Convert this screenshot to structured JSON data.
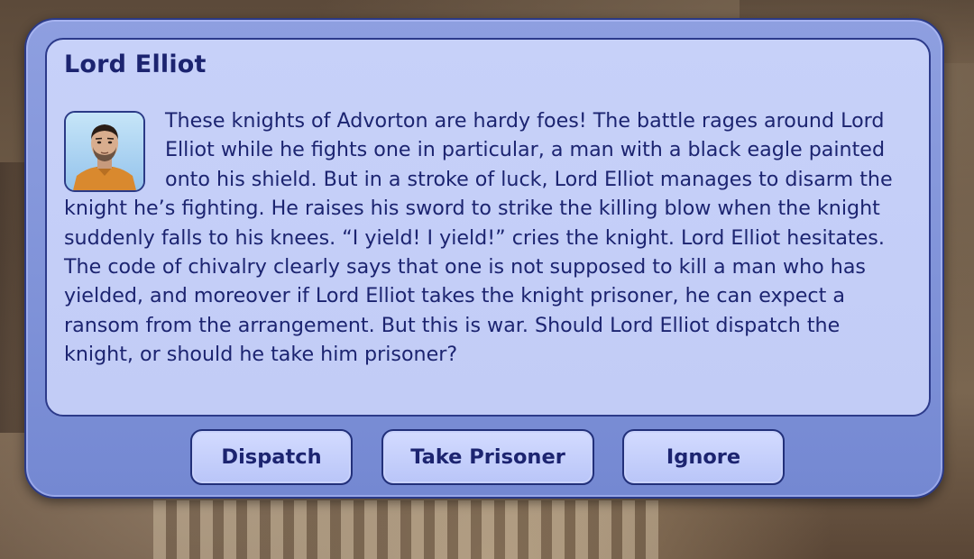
{
  "dialog": {
    "title": "Lord Elliot",
    "portrait_icon": "sim-portrait-icon",
    "message": "These knights of Advorton are hardy foes! The battle rages around Lord Elliot while he fights one in particular, a man with a black eagle painted onto his shield. But in a stroke of luck, Lord Elliot manages to disarm the knight he’s fighting. He raises his sword to strike the killing blow when the knight suddenly falls to his knees. “I yield! I yield!” cries the knight. Lord Elliot hesitates. The code of chivalry clearly says that one is not supposed to kill a man who has yielded, and moreover if Lord Elliot takes the knight prisoner, he can expect a ransom from the arrangement. But this is war. Should Lord Elliot dispatch the knight, or should he take him prisoner?"
  },
  "buttons": {
    "dispatch": "Dispatch",
    "take_prisoner": "Take Prisoner",
    "ignore": "Ignore"
  },
  "colors": {
    "dialog_bg": "#8e9fe0",
    "panel_bg": "#c7d1f9",
    "text": "#1c2470",
    "border": "#2b3a86"
  }
}
